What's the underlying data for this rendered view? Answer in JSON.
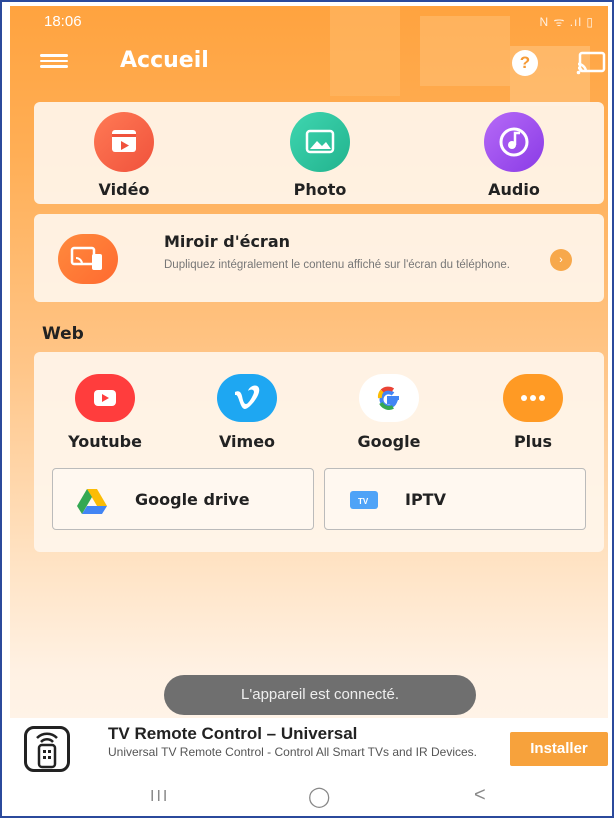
{
  "status_bar": {
    "time": "18:06",
    "icons": "N ᯤ .ıl ▯"
  },
  "app_bar": {
    "title": "Accueil",
    "help": "?"
  },
  "media": [
    {
      "label": "Vidéo",
      "color": "#ff6b4a",
      "icon": "video-icon"
    },
    {
      "label": "Photo",
      "color": "#2fc7a3",
      "icon": "image-icon"
    },
    {
      "label": "Audio",
      "color": "#a553f0",
      "icon": "music-icon"
    }
  ],
  "mirror": {
    "title": "Miroir d'écran",
    "description": "Dupliquez intégralement le contenu affiché sur l'écran du téléphone.",
    "arrow": "›"
  },
  "web": {
    "section_label": "Web",
    "services": [
      {
        "label": "Youtube",
        "color": "#ff3d3d",
        "icon": "youtube-icon"
      },
      {
        "label": "Vimeo",
        "color": "#1ea7f2",
        "icon": "vimeo-icon"
      },
      {
        "label": "Google",
        "color": "#ffffff",
        "icon": "google-icon"
      },
      {
        "label": "Plus",
        "color": "#ff9a24",
        "icon": "more-icon"
      }
    ],
    "buttons": [
      {
        "label": "Google drive",
        "icon": "google-drive-icon"
      },
      {
        "label": "IPTV",
        "icon": "tv-icon"
      }
    ]
  },
  "toast": "L'appareil est connecté.",
  "ad": {
    "title": "TV Remote Control – Universal",
    "description": "Universal TV Remote Control - Control All Smart TVs and IR Devices.",
    "button": "Installer"
  },
  "nav_bar": {
    "recents": "III",
    "home": "◯",
    "back": "<"
  }
}
